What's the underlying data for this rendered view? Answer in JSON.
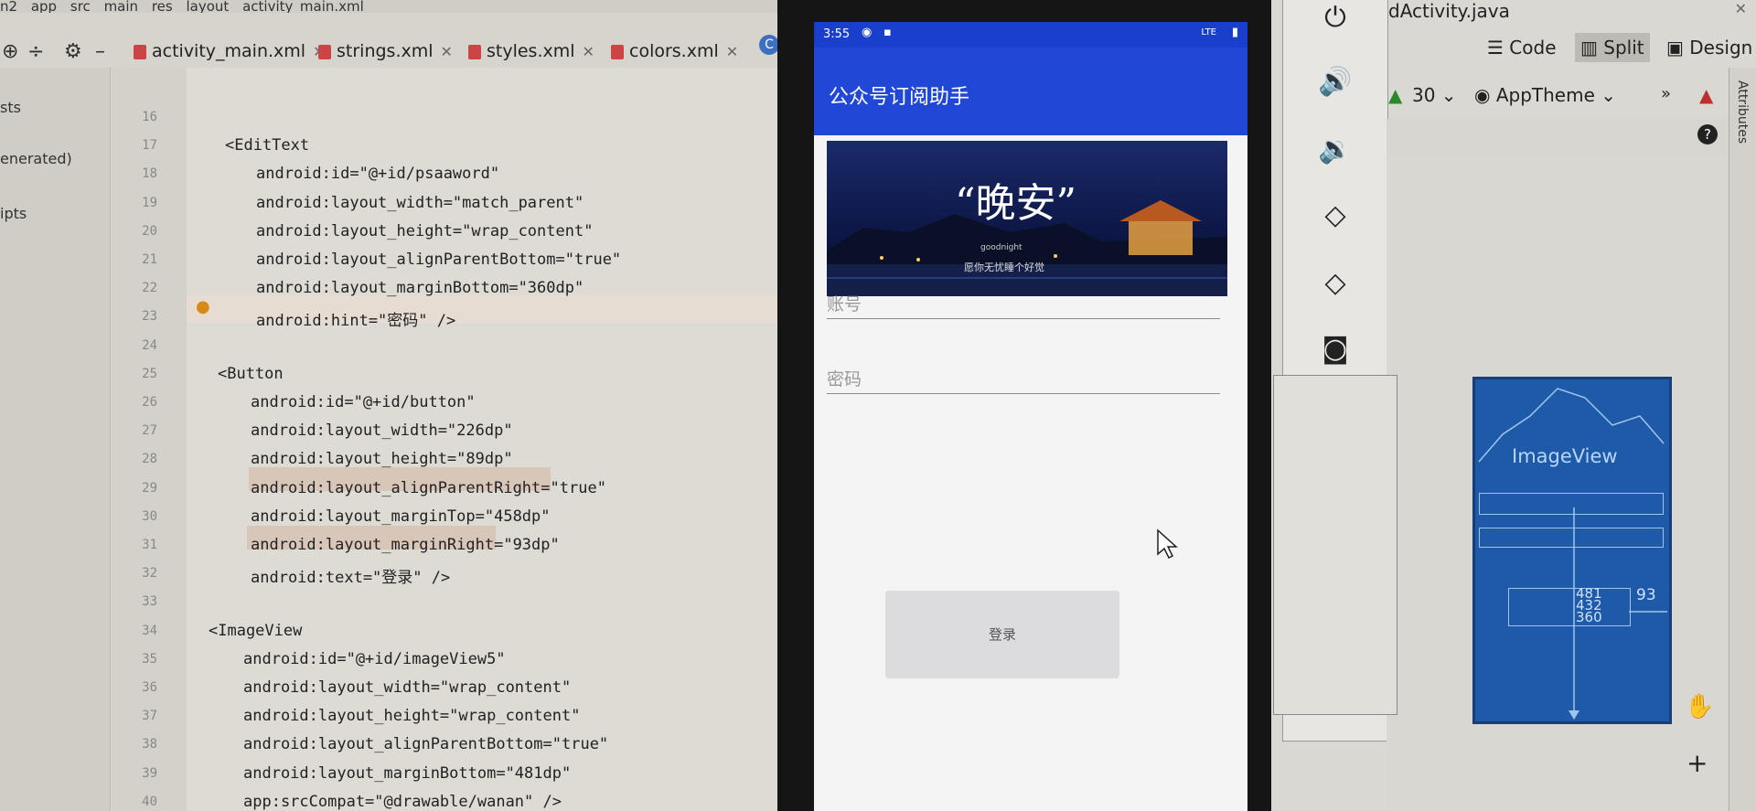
{
  "breadcrumbs": [
    "n2",
    "app",
    "src",
    "main",
    "res",
    "layout",
    "activity_main.xml"
  ],
  "editor_tabs": [
    {
      "label": "activity_main.xml",
      "active": true
    },
    {
      "label": "strings.xml",
      "active": false
    },
    {
      "label": "styles.xml",
      "active": false
    },
    {
      "label": "colors.xml",
      "active": false
    }
  ],
  "right_tab": "dActivity.java",
  "view_modes": {
    "code": "Code",
    "split": "Split",
    "design": "Design"
  },
  "design_toolbar": {
    "api_level": "30",
    "theme": "AppTheme"
  },
  "left_panel_items": [
    "sts",
    "enerated)",
    "ipts"
  ],
  "code_lines": [
    {
      "num": "16",
      "text": ""
    },
    {
      "num": "17",
      "text": "<EditText"
    },
    {
      "num": "18",
      "text": "    android:id=\"@+id/psaaword\""
    },
    {
      "num": "19",
      "text": "    android:layout_width=\"match_parent\""
    },
    {
      "num": "20",
      "text": "    android:layout_height=\"wrap_content\""
    },
    {
      "num": "21",
      "text": "    android:layout_alignParentBottom=\"true\""
    },
    {
      "num": "22",
      "text": "    android:layout_marginBottom=\"360dp\""
    },
    {
      "num": "23",
      "text": "    android:hint=\"密码\" />"
    },
    {
      "num": "24",
      "text": ""
    },
    {
      "num": "25",
      "text": "<Button"
    },
    {
      "num": "26",
      "text": "    android:id=\"@+id/button\""
    },
    {
      "num": "27",
      "text": "    android:layout_width=\"226dp\""
    },
    {
      "num": "28",
      "text": "    android:layout_height=\"89dp\""
    },
    {
      "num": "29",
      "text": "    android:layout_alignParentRight=\"true\""
    },
    {
      "num": "30",
      "text": "    android:layout_marginTop=\"458dp\""
    },
    {
      "num": "31",
      "text": "    android:layout_marginRight=\"93dp\""
    },
    {
      "num": "32",
      "text": "    android:text=\"登录\" />"
    },
    {
      "num": "33",
      "text": ""
    },
    {
      "num": "34",
      "text": "<ImageView"
    },
    {
      "num": "35",
      "text": "    android:id=\"@+id/imageView5\""
    },
    {
      "num": "36",
      "text": "    android:layout_width=\"wrap_content\""
    },
    {
      "num": "37",
      "text": "    android:layout_height=\"wrap_content\""
    },
    {
      "num": "38",
      "text": "    android:layout_alignParentBottom=\"true\""
    },
    {
      "num": "39",
      "text": "    android:layout_marginBottom=\"481dp\""
    },
    {
      "num": "40",
      "text": "    app:srcCompat=\"@drawable/wanan\" />"
    }
  ],
  "phone": {
    "status_time": "3:55",
    "status_right": "LTE",
    "app_title": "公众号订阅助手",
    "banner_title": "“晚安”",
    "banner_sub_small": "goodnight",
    "banner_sub": "愿你无忧睡个好觉",
    "username_hint": "账号",
    "password_hint": "密码",
    "login_button": "登录"
  },
  "blueprint": {
    "label": "ImageView",
    "numbers": [
      "481",
      "432",
      "360"
    ],
    "right_margin": "93"
  }
}
